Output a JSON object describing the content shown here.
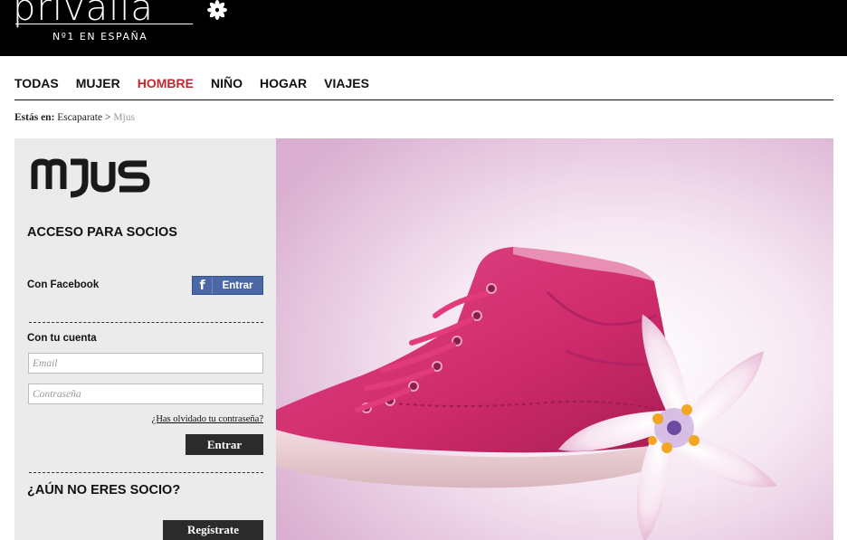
{
  "header": {
    "logo_text": "privalia",
    "tagline": "Nº1 EN ESPAÑA"
  },
  "nav": {
    "items": [
      {
        "label": "TODAS",
        "active": false
      },
      {
        "label": "MUJER",
        "active": false
      },
      {
        "label": "HOMBRE",
        "active": true
      },
      {
        "label": "NIÑO",
        "active": false
      },
      {
        "label": "HOGAR",
        "active": false
      },
      {
        "label": "VIAJES",
        "active": false
      }
    ],
    "active_color": "#c0272d"
  },
  "breadcrumb": {
    "label": "Estás en:",
    "link": "Escaparate",
    "separator": ">",
    "current": "Mjus"
  },
  "login": {
    "brand": "MJUS",
    "title": "ACCESO PARA SOCIOS",
    "facebook_label": "Con Facebook",
    "facebook_button": "Entrar",
    "facebook_icon": "facebook-icon",
    "account_label": "Con tu cuenta",
    "email_placeholder": "Email",
    "password_placeholder": "Contraseña",
    "forgot_link": "¿Has olvidado tu contraseña?",
    "submit_button": "Entrar",
    "not_member_title": "¿AÚN NO ERES SOCIO?",
    "register_button": "Regístrate"
  },
  "colors": {
    "header_bg": "#000000",
    "panel_bg": "#ebebeb",
    "facebook_blue": "#4a68a6",
    "button_dark": "#2b2b2b",
    "shoe_pink": "#d42c6e"
  }
}
